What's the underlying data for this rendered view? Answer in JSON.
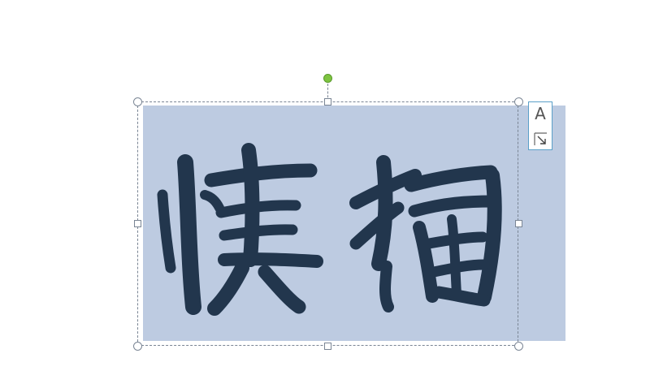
{
  "colors": {
    "shape_fill": "#bdcbe1",
    "text_ink": "#22364d",
    "selection_line": "#7a8594",
    "rotate_handle": "#7ec440",
    "layout_button_border": "#5aa0c8"
  },
  "icons": {
    "rotate": "rotate-handle-icon",
    "layout": "layout-options-icon",
    "expand": "expand-arrow-icon"
  },
  "layout_options": {
    "letter": "A"
  },
  "calligraphy": {
    "text": "慎獨"
  }
}
